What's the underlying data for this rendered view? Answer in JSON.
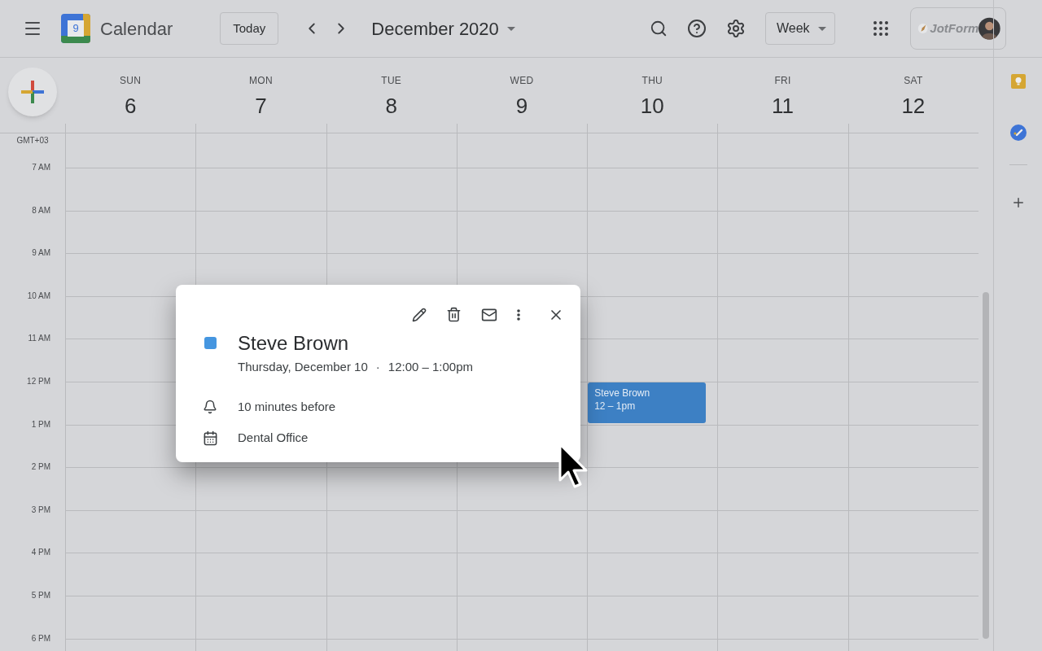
{
  "header": {
    "app_name": "Calendar",
    "logo_day": "9",
    "today_button": "Today",
    "period": "December 2020",
    "view": "Week",
    "brand": "JotForm"
  },
  "timezone": "GMT+03",
  "days": [
    {
      "weekday": "SUN",
      "date": "6"
    },
    {
      "weekday": "MON",
      "date": "7"
    },
    {
      "weekday": "TUE",
      "date": "8"
    },
    {
      "weekday": "WED",
      "date": "9"
    },
    {
      "weekday": "THU",
      "date": "10",
      "events": [
        {
          "title": "Steve Brown",
          "time": "12 – 1pm",
          "color": "#3d80c4"
        }
      ]
    },
    {
      "weekday": "FRI",
      "date": "11"
    },
    {
      "weekday": "SAT",
      "date": "12"
    }
  ],
  "hours": [
    "7 AM",
    "8 AM",
    "9 AM",
    "10 AM",
    "11 AM",
    "12 PM",
    "1 PM",
    "2 PM",
    "3 PM",
    "4 PM",
    "5 PM",
    "6 PM"
  ],
  "popup": {
    "title": "Steve Brown",
    "color": "#4596e0",
    "date": "Thursday, December 10",
    "separator": "·",
    "time": "12:00 – 1:00pm",
    "reminder": "10 minutes before",
    "calendar": "Dental Office"
  }
}
